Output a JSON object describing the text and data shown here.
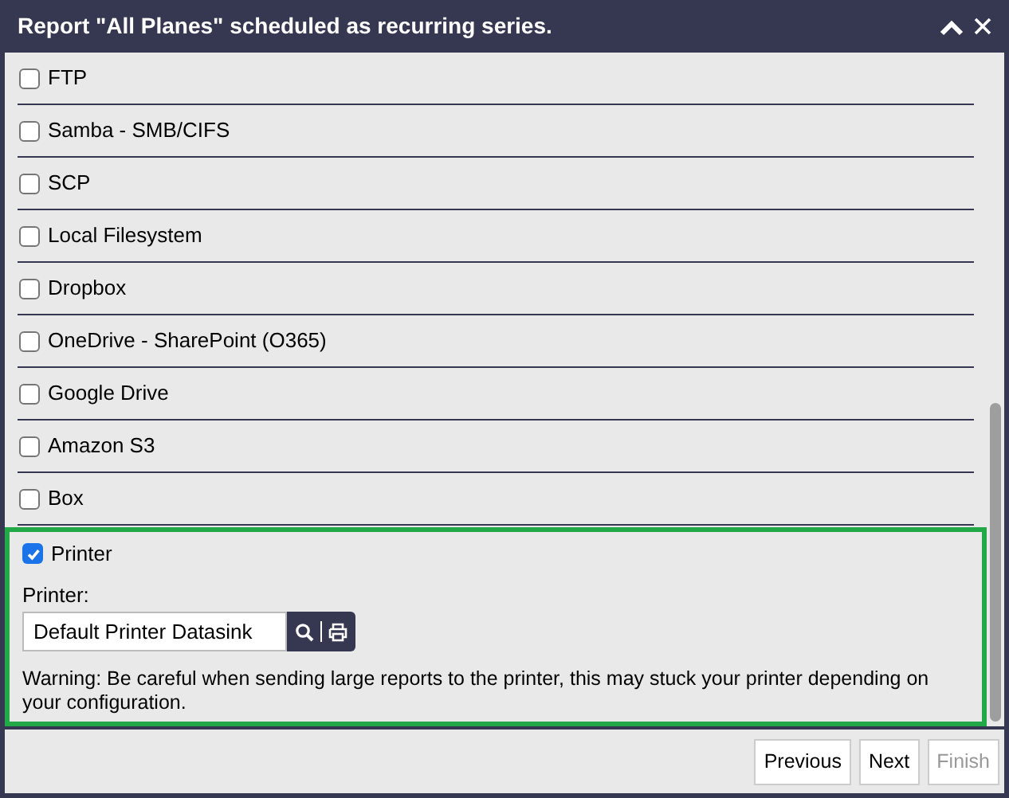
{
  "window": {
    "title": "Report \"All Planes\" scheduled as recurring series."
  },
  "options": [
    {
      "label": "FTP",
      "checked": false
    },
    {
      "label": "Samba - SMB/CIFS",
      "checked": false
    },
    {
      "label": "SCP",
      "checked": false
    },
    {
      "label": "Local Filesystem",
      "checked": false
    },
    {
      "label": "Dropbox",
      "checked": false
    },
    {
      "label": "OneDrive - SharePoint (O365)",
      "checked": false
    },
    {
      "label": "Google Drive",
      "checked": false
    },
    {
      "label": "Amazon S3",
      "checked": false
    },
    {
      "label": "Box",
      "checked": false
    }
  ],
  "printer": {
    "label": "Printer",
    "checked": true,
    "field_label": "Printer:",
    "value": "Default Printer Datasink",
    "warning": "Warning: Be careful when sending large reports to the printer, this may stuck your printer depending on your configuration."
  },
  "buttons": [
    {
      "label": "Previous",
      "disabled": false
    },
    {
      "label": "Next",
      "disabled": false
    },
    {
      "label": "Finish",
      "disabled": true
    }
  ]
}
